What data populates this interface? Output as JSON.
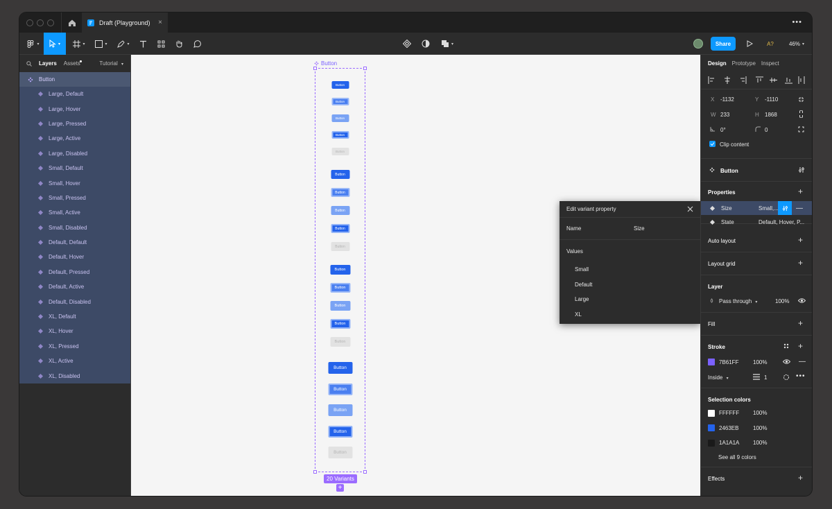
{
  "titlebar": {
    "tab_title": "Draft (Playground)",
    "close": "×",
    "more": "•••"
  },
  "toolbar": {
    "share_label": "Share",
    "zoom": "46%",
    "font_badge": "A?"
  },
  "left_panel": {
    "tabs": {
      "layers": "Layers",
      "assets": "Assets",
      "page": "Tutorial"
    },
    "root": "Button",
    "items": [
      "Large, Default",
      "Large, Hover",
      "Large, Pressed",
      "Large, Active",
      "Large, Disabled",
      "Small, Default",
      "Small, Hover",
      "Small, Pressed",
      "Small, Active",
      "Small, Disabled",
      "Default, Default",
      "Default, Hover",
      "Default, Pressed",
      "Default, Active",
      "Default, Disabled",
      "XL, Default",
      "XL, Hover",
      "XL, Pressed",
      "XL, Active",
      "XL, Disabled"
    ]
  },
  "canvas": {
    "frame_label": "Button",
    "button_label": "Button",
    "variants_badge": "20 Variants"
  },
  "popup": {
    "title": "Edit variant property",
    "name_label": "Name",
    "name_value": "Size",
    "values_label": "Values",
    "values": [
      "Small",
      "Default",
      "Large",
      "XL"
    ]
  },
  "right_panel": {
    "tabs": {
      "design": "Design",
      "prototype": "Prototype",
      "inspect": "Inspect"
    },
    "x_label": "X",
    "x_value": "-1132",
    "y_label": "Y",
    "y_value": "-1110",
    "w_label": "W",
    "w_value": "233",
    "h_label": "H",
    "h_value": "1868",
    "rotation": "0°",
    "radius": "0",
    "clip_content": "Clip content",
    "component_name": "Button",
    "properties_title": "Properties",
    "properties": [
      {
        "name": "Size",
        "value": "Small,..."
      },
      {
        "name": "State",
        "value": "Default, Hover, P..."
      }
    ],
    "auto_layout": "Auto layout",
    "layout_grid": "Layout grid",
    "layer_title": "Layer",
    "blend_mode": "Pass through",
    "layer_opacity": "100%",
    "fill_title": "Fill",
    "stroke_title": "Stroke",
    "stroke_color": "7B61FF",
    "stroke_opacity": "100%",
    "stroke_position": "Inside",
    "stroke_weight": "1",
    "selection_colors_title": "Selection colors",
    "selection_colors": [
      {
        "hex": "FFFFFF",
        "opacity": "100%",
        "color": "#FFFFFF"
      },
      {
        "hex": "2463EB",
        "opacity": "100%",
        "color": "#2463EB"
      },
      {
        "hex": "1A1A1A",
        "opacity": "100%",
        "color": "#1A1A1A"
      }
    ],
    "see_all": "See all 9 colors",
    "effects_title": "Effects"
  },
  "colors": {
    "accent": "#0d99ff",
    "component": "#9b6cff",
    "button_blue": "#2463EB"
  }
}
